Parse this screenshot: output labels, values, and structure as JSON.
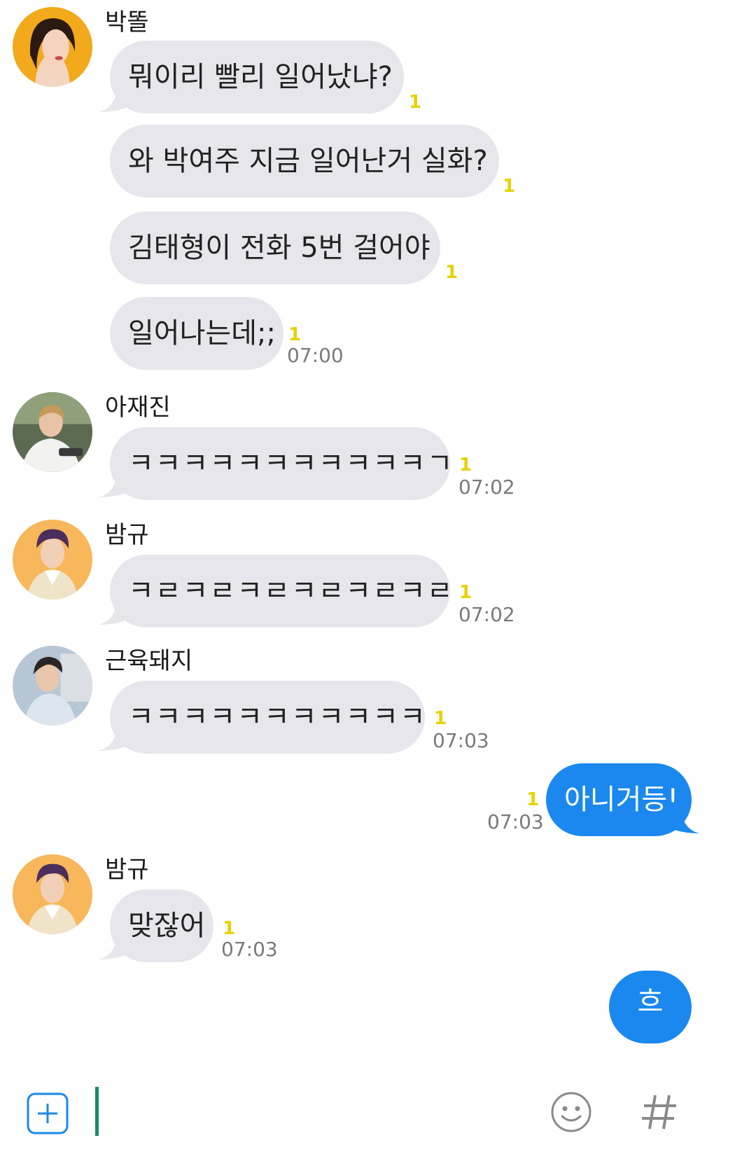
{
  "colors": {
    "incoming_bubble": "#e6e6ec",
    "outgoing_bubble": "#1a88ee",
    "unread": "#e6d200",
    "accent": "#1a88ee"
  },
  "messages": [
    {
      "sender": "박똘",
      "avatar": "profile-photo",
      "bubbles": [
        {
          "text": "뭐이리 빨리 일어났냐?",
          "unread": "1"
        },
        {
          "text": "와 박여주 지금 일어난거 실화?",
          "unread": "1"
        },
        {
          "text": "김태형이 전화 5번 걸어야",
          "unread": "1"
        },
        {
          "text": "일어나는데;;",
          "unread": "1",
          "time": "07:00"
        }
      ]
    },
    {
      "sender": "아재진",
      "avatar": "profile-photo",
      "bubbles": [
        {
          "text": "ㅋㅋㅋㅋㅋㅋㅋㅋㅋㅋㅋㄱ",
          "unread": "1",
          "time": "07:02"
        }
      ]
    },
    {
      "sender": "밤규",
      "avatar": "profile-photo",
      "bubbles": [
        {
          "text": "ㅋㄹㅋㄹㅋㄹㅋㄹㅋㄹㅋㄹ",
          "unread": "1",
          "time": "07:02"
        }
      ]
    },
    {
      "sender": "근육돼지",
      "avatar": "profile-photo",
      "bubbles": [
        {
          "text": "ㅋㅋㅋㅋㅋㅋㅋㅋㅋㅋㅋ",
          "unread": "1",
          "time": "07:03"
        }
      ]
    },
    {
      "sender": "me",
      "bubbles": [
        {
          "text": "아니거등!",
          "unread": "1",
          "time": "07:03"
        }
      ]
    },
    {
      "sender": "밤규",
      "avatar": "profile-photo",
      "bubbles": [
        {
          "text": "맞잖어",
          "unread": "1",
          "time": "07:03"
        }
      ]
    },
    {
      "sender": "me",
      "bubbles": [
        {
          "text": "흐",
          "partial": true
        }
      ]
    }
  ],
  "input_bar": {
    "placeholder": "",
    "icons": [
      "plus-icon",
      "emoji-icon",
      "hashtag-icon"
    ]
  }
}
